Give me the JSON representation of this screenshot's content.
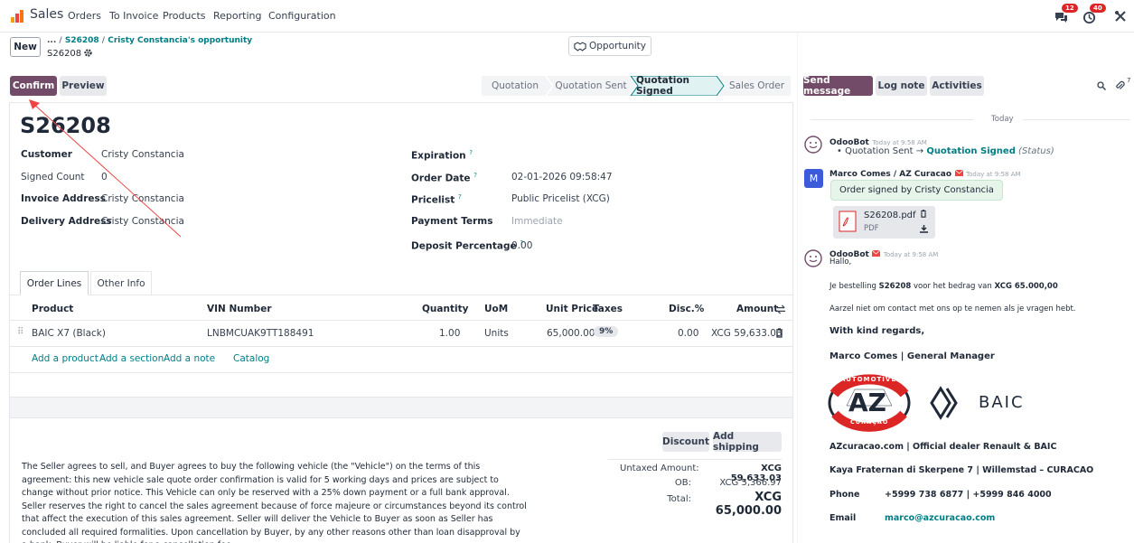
{
  "nav": {
    "app_name": "Sales",
    "menu": [
      "Orders",
      "To Invoice",
      "Products",
      "Reporting",
      "Configuration"
    ],
    "badge_messages": "12",
    "badge_activities": "40"
  },
  "control": {
    "new_label": "New",
    "breadcrumb_dots": "...",
    "breadcrumb_sep": "/",
    "breadcrumb_1": "S26208",
    "breadcrumb_2": "Cristy Constancia's opportunity",
    "record_name": "S26208",
    "smart_button": "Opportunity"
  },
  "actions": {
    "confirm": "Confirm",
    "preview": "Preview"
  },
  "status": {
    "stages": [
      "Quotation",
      "Quotation Sent",
      "Quotation Signed",
      "Sales Order"
    ],
    "active": "Quotation Signed"
  },
  "form": {
    "title": "S26208",
    "left": [
      {
        "label": "Customer",
        "value": "Cristy Constancia"
      },
      {
        "label": "Signed Count",
        "value": "0"
      },
      {
        "label": "Invoice Address",
        "value": "Cristy Constancia"
      },
      {
        "label": "Delivery Address",
        "value": "Cristy Constancia"
      }
    ],
    "right": [
      {
        "label": "Expiration",
        "value": ""
      },
      {
        "label": "Order Date",
        "value": "02-01-2026 09:58:47"
      },
      {
        "label": "Pricelist",
        "value": "Public Pricelist (XCG)"
      },
      {
        "label": "Payment Terms",
        "value": "Immediate"
      },
      {
        "label": "Deposit Percentage",
        "value": "0.00"
      }
    ],
    "help_mark": "?"
  },
  "tabs": [
    "Order Lines",
    "Other Info"
  ],
  "table": {
    "headers": [
      "Product",
      "VIN Number",
      "Quantity",
      "UoM",
      "Unit Price",
      "Taxes",
      "Disc.%",
      "Amount"
    ],
    "row": {
      "product": "BAIC X7 (Black)",
      "vin": "LNBMCUAK9TT188491",
      "quantity": "1.00",
      "uom": "Units",
      "unit_price": "65,000.00",
      "taxes": "9%",
      "disc": "0.00",
      "amount": "XCG 59,633.03"
    },
    "add_links": [
      "Add a product",
      "Add a section",
      "Add a note",
      "Catalog"
    ]
  },
  "footer": {
    "discount": "Discount",
    "add_shipping": "Add shipping",
    "terms": "The Seller agrees to sell, and Buyer agrees to buy the following vehicle (the \"Vehicle\") on the terms of this agreement: this new vehicle sale quote order confirmation is valid for 5 working days and prices are subject to change without prior notice. This Vehicle can only be reserved with a 25% down payment or a full bank approval. Seller reserves the right to cancel the sales agreement because of force majeure or circumstances beyond its control that affect the execution of this sales agreement. Seller will deliver the Vehicle to Buyer as soon as Seller has concluded all required formalities. Upon cancellation by Buyer, by any other reasons other than loan disapproval by a bank, Buyer will be liable for a cancellation fee",
    "untaxed_label": "Untaxed Amount:",
    "untaxed_value": "XCG 59,633.03",
    "ob_label": "OB:",
    "ob_value": "XCG 5,366.97",
    "total_label": "Total:",
    "total_value": "XCG 65,000.00"
  },
  "chatter": {
    "send_message": "Send message",
    "log_note": "Log note",
    "activities": "Activities",
    "followers_count": "7",
    "today": "Today",
    "msg1": {
      "author": "OdooBot",
      "time": "Today at 9:58 AM",
      "from": "Quotation Sent",
      "arrow": "→",
      "to": "Quotation Signed",
      "field": "(Status)"
    },
    "msg2": {
      "author": "Marco Comes / AZ Curacao",
      "avatar": "M",
      "time": "Today at 9:58 AM",
      "body": "Order signed by Cristy Constancia",
      "file_name": "S26208.pdf",
      "file_type": "PDF"
    },
    "msg3": {
      "author": "OdooBot",
      "time": "Today at 9:58 AM",
      "greeting": "Hallo,",
      "line1_a": "Je bestelling ",
      "line1_b": "S26208",
      "line1_c": " voor het bedrag van ",
      "line1_d": "XCG 65.000,00",
      "line2": "Aarzel niet om contact met ons op te nemen als je vragen hebt.",
      "regards": "With kind regards,",
      "signature": "Marco Comes | General Manager",
      "logo_top": "AUTOMOTIVE",
      "logo_mid": "AZ",
      "logo_bottom": "CURAÇAO",
      "brand": "BAIC",
      "dealer": "AZcuracao.com | Official dealer Renault & BAIC",
      "address": "Kaya Fraternan di Skerpene 7 | Willemstad – CURACAO",
      "phone_label": "Phone",
      "phone": "+5999 738 6877 | +5999 846 4000",
      "email_label": "Email",
      "email": "marco@azcuracao.com"
    }
  }
}
